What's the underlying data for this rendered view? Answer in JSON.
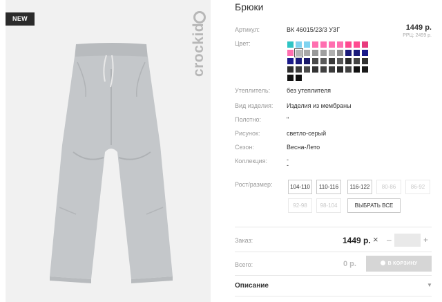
{
  "photo": {
    "badge": "NEW",
    "brand": "crockid"
  },
  "product": {
    "title": "Брюки",
    "price": "1449 р.",
    "rrp": "РРЦ: 2499 р."
  },
  "attributes": {
    "article_label": "Артикул:",
    "article_value": "ВК 46015/23/3 УЗГ",
    "color_label": "Цвет:",
    "insulation_label": "Утеплитель:",
    "insulation_value": "без утеплителя",
    "type_label": "Вид изделия:",
    "type_value": "Изделия из мембраны",
    "fabric_label": "Полотно:",
    "fabric_value": "\"",
    "pattern_label": "Рисунок:",
    "pattern_value": "светло-серый",
    "season_label": "Сезон:",
    "season_value": "Весна-Лето",
    "collection_label": "Коллекция:",
    "collection_value": "-",
    "collection_value2": "-",
    "size_label": "Рост/размер:"
  },
  "colors": [
    "#2ec4c4",
    "#7fd3f0",
    "#7fd3f0",
    "#ff6fb0",
    "#ff6fb0",
    "#ff6fb0",
    "#ff6fb0",
    "#ff4a90",
    "#ff4a90",
    "#e83c7e",
    "#ff6fb0",
    "#b4b4b4",
    "#a8a8a8",
    "#9a9a9a",
    "#a0a0a0",
    "#b0b0b0",
    "#8f8f8f",
    "#1a1a7a",
    "#1a1a7a",
    "#1a1a8a",
    "#1a1a8a",
    "#1a1a7a",
    "#1a1a6a",
    "#4a4a4a",
    "#5a5a5a",
    "#3a3a3a",
    "#555555",
    "#2a2a2a",
    "#444444",
    "#333333",
    "#2d2d2d",
    "#3b3b3b",
    "#4b4b4b",
    "#333333",
    "#404040",
    "#3a3a3a",
    "#2a2a2a",
    "#404040",
    "#111111",
    "#1a1a1a",
    "#111111",
    "#0e0e0e"
  ],
  "sizes": [
    {
      "label": "104-110",
      "state": "active"
    },
    {
      "label": "110-116",
      "state": "active"
    },
    {
      "label": "116-122",
      "state": "active"
    },
    {
      "label": "80-86",
      "state": "off"
    },
    {
      "label": "86-92",
      "state": "off"
    },
    {
      "label": "92-98",
      "state": "off"
    },
    {
      "label": "98-104",
      "state": "off"
    },
    {
      "label": "ВЫБРАТЬ ВСЕ",
      "state": "active"
    }
  ],
  "order": {
    "label": "Заказ:",
    "price": "1449 р.",
    "times_icon": "times-icon",
    "minus_icon": "minus-icon",
    "plus_icon": "plus-icon",
    "quantity": ""
  },
  "total": {
    "label": "Всего:",
    "value": "0 р.",
    "cart_button": "В КОРЗИНУ"
  },
  "description": {
    "label": "Описание",
    "chevron_icon": "chevron-down-icon"
  }
}
